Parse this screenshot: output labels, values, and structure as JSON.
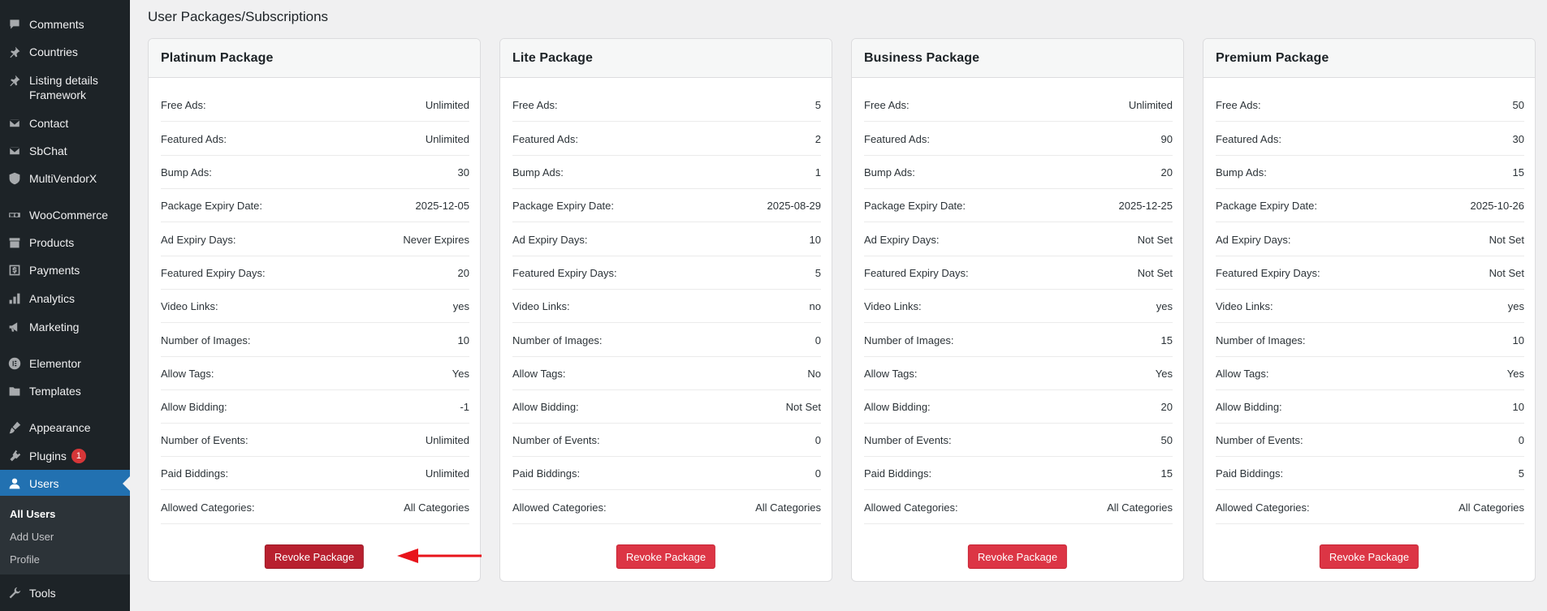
{
  "sidebar": {
    "items": [
      {
        "label": "Comments",
        "icon": "comment-icon"
      },
      {
        "label": "Countries",
        "icon": "pin-icon"
      },
      {
        "label": "Listing details Framework",
        "icon": "pin-icon"
      },
      {
        "label": "Contact",
        "icon": "mail-icon"
      },
      {
        "label": "SbChat",
        "icon": "mail-icon"
      },
      {
        "label": "MultiVendorX",
        "icon": "shield-icon"
      },
      {
        "label": "WooCommerce",
        "icon": "woo-icon"
      },
      {
        "label": "Products",
        "icon": "archive-icon"
      },
      {
        "label": "Payments",
        "icon": "dollar-icon"
      },
      {
        "label": "Analytics",
        "icon": "chart-bar-icon"
      },
      {
        "label": "Marketing",
        "icon": "megaphone-icon"
      },
      {
        "label": "Elementor",
        "icon": "elementor-icon"
      },
      {
        "label": "Templates",
        "icon": "folder-icon"
      },
      {
        "label": "Appearance",
        "icon": "brush-icon"
      },
      {
        "label": "Plugins",
        "icon": "plug-icon",
        "badge": "1"
      },
      {
        "label": "Users",
        "icon": "user-icon"
      },
      {
        "label": "Tools",
        "icon": "wrench-icon"
      }
    ],
    "submenu": [
      "All Users",
      "Add User",
      "Profile"
    ]
  },
  "page": {
    "title": "User Packages/Subscriptions"
  },
  "row_labels": [
    "Free Ads:",
    "Featured Ads:",
    "Bump Ads:",
    "Package Expiry Date:",
    "Ad Expiry Days:",
    "Featured Expiry Days:",
    "Video Links:",
    "Number of Images:",
    "Allow Tags:",
    "Allow Bidding:",
    "Number of Events:",
    "Paid Biddings:",
    "Allowed Categories:"
  ],
  "packages": [
    {
      "title": "Platinum Package",
      "values": [
        "Unlimited",
        "Unlimited",
        "30",
        "2025-12-05",
        "Never Expires",
        "20",
        "yes",
        "10",
        "Yes",
        "-1",
        "Unlimited",
        "Unlimited",
        "All Categories"
      ],
      "button": "Revoke Package"
    },
    {
      "title": "Lite Package",
      "values": [
        "5",
        "2",
        "1",
        "2025-08-29",
        "10",
        "5",
        "no",
        "0",
        "No",
        "Not Set",
        "0",
        "0",
        "All Categories"
      ],
      "button": "Revoke Package"
    },
    {
      "title": "Business Package",
      "values": [
        "Unlimited",
        "90",
        "20",
        "2025-12-25",
        "Not Set",
        "Not Set",
        "yes",
        "15",
        "Yes",
        "20",
        "50",
        "15",
        "All Categories"
      ],
      "button": "Revoke Package"
    },
    {
      "title": "Premium Package",
      "values": [
        "50",
        "30",
        "15",
        "2025-10-26",
        "Not Set",
        "Not Set",
        "yes",
        "10",
        "Yes",
        "10",
        "0",
        "5",
        "All Categories"
      ],
      "button": "Revoke Package"
    }
  ],
  "colors": {
    "sidebar": "#1d2327",
    "active": "#2271b1",
    "button": "#dc3545",
    "arrow": "#e8141b",
    "badge": "#d63638"
  }
}
